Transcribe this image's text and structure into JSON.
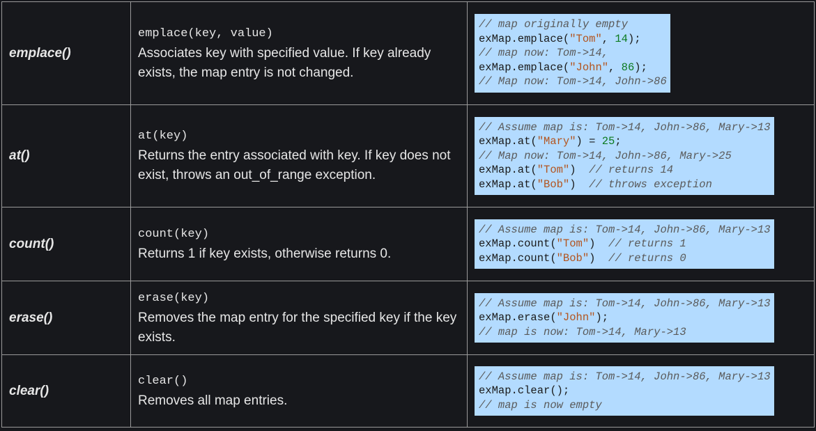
{
  "rows": [
    {
      "name": "emplace()",
      "signature": "emplace(key, value)",
      "description": "Associates key with specified value. If key already exists, the map entry is not changed.",
      "code": [
        [
          {
            "t": "cmt",
            "v": "// map originally empty"
          }
        ],
        [
          {
            "t": "pln",
            "v": "exMap.emplace("
          },
          {
            "t": "str",
            "v": "\"Tom\""
          },
          {
            "t": "pln",
            "v": ", "
          },
          {
            "t": "num",
            "v": "14"
          },
          {
            "t": "pln",
            "v": ");"
          }
        ],
        [
          {
            "t": "cmt",
            "v": "// map now: Tom->14,"
          }
        ],
        [
          {
            "t": "pln",
            "v": "exMap.emplace("
          },
          {
            "t": "str",
            "v": "\"John\""
          },
          {
            "t": "pln",
            "v": ", "
          },
          {
            "t": "num",
            "v": "86"
          },
          {
            "t": "pln",
            "v": ");"
          }
        ],
        [
          {
            "t": "cmt",
            "v": "// Map now: Tom->14, John->86"
          }
        ]
      ]
    },
    {
      "name": "at()",
      "signature": "at(key)",
      "description": "Returns the entry associated with key. If key does not exist, throws an out_of_range exception.",
      "code": [
        [
          {
            "t": "cmt",
            "v": "// Assume map is: Tom->14, John->86, Mary->13"
          }
        ],
        [
          {
            "t": "pln",
            "v": "exMap.at("
          },
          {
            "t": "str",
            "v": "\"Mary\""
          },
          {
            "t": "pln",
            "v": ") = "
          },
          {
            "t": "num",
            "v": "25"
          },
          {
            "t": "pln",
            "v": ";"
          }
        ],
        [
          {
            "t": "cmt",
            "v": "// Map now: Tom->14, John->86, Mary->25"
          }
        ],
        [
          {
            "t": "pln",
            "v": "exMap.at("
          },
          {
            "t": "str",
            "v": "\"Tom\""
          },
          {
            "t": "pln",
            "v": ")  "
          },
          {
            "t": "cmt",
            "v": "// returns 14"
          }
        ],
        [
          {
            "t": "pln",
            "v": "exMap.at("
          },
          {
            "t": "str",
            "v": "\"Bob\""
          },
          {
            "t": "pln",
            "v": ")  "
          },
          {
            "t": "cmt",
            "v": "// throws exception"
          }
        ]
      ]
    },
    {
      "name": "count()",
      "signature": "count(key)",
      "description": "Returns 1 if key exists, otherwise returns 0.",
      "code": [
        [
          {
            "t": "cmt",
            "v": "// Assume map is: Tom->14, John->86, Mary->13"
          }
        ],
        [
          {
            "t": "pln",
            "v": "exMap.count("
          },
          {
            "t": "str",
            "v": "\"Tom\""
          },
          {
            "t": "pln",
            "v": ")  "
          },
          {
            "t": "cmt",
            "v": "// returns 1"
          }
        ],
        [
          {
            "t": "pln",
            "v": "exMap.count("
          },
          {
            "t": "str",
            "v": "\"Bob\""
          },
          {
            "t": "pln",
            "v": ")  "
          },
          {
            "t": "cmt",
            "v": "// returns 0"
          }
        ]
      ]
    },
    {
      "name": "erase()",
      "signature": "erase(key)",
      "description": "Removes the map entry for the specified key if the key exists.",
      "code": [
        [
          {
            "t": "cmt",
            "v": "// Assume map is: Tom->14, John->86, Mary->13"
          }
        ],
        [
          {
            "t": "pln",
            "v": "exMap.erase("
          },
          {
            "t": "str",
            "v": "\"John\""
          },
          {
            "t": "pln",
            "v": ");"
          }
        ],
        [
          {
            "t": "cmt",
            "v": "// map is now: Tom->14, Mary->13"
          }
        ]
      ]
    },
    {
      "name": "clear()",
      "signature": "clear()",
      "description": "Removes all map entries.",
      "code": [
        [
          {
            "t": "cmt",
            "v": "// Assume map is: Tom->14, John->86, Mary->13"
          }
        ],
        [
          {
            "t": "pln",
            "v": "exMap.clear();"
          }
        ],
        [
          {
            "t": "cmt",
            "v": "// map is now empty"
          }
        ]
      ]
    }
  ]
}
